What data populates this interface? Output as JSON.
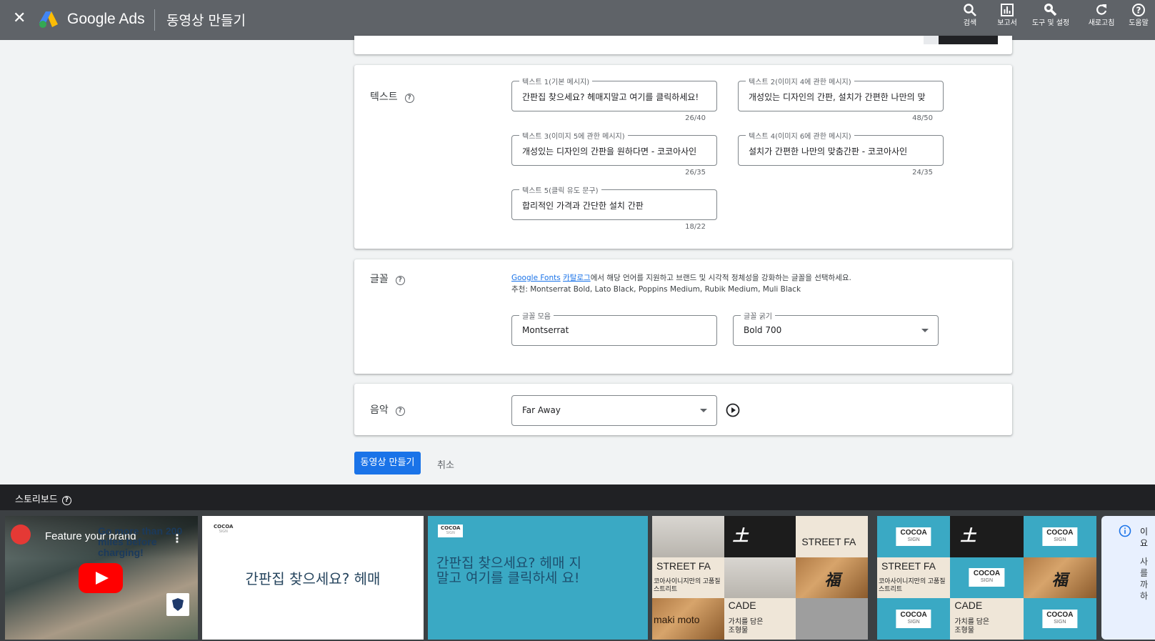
{
  "header": {
    "close_glyph": "✕",
    "brand": "Google Ads",
    "page_title": "동영상 만들기",
    "tools": [
      {
        "label": "검색",
        "icon": "search-icon"
      },
      {
        "label": "보고서",
        "icon": "bar-chart-icon"
      },
      {
        "label": "도구 및 설정",
        "icon": "wrench-icon"
      },
      {
        "label": "새로고침",
        "icon": "refresh-icon"
      },
      {
        "label": "도움말",
        "icon": "help-icon"
      }
    ],
    "bg_color": "#5f6368"
  },
  "text_section": {
    "title": "텍스트",
    "help_glyph": "?",
    "fields": [
      {
        "label": "텍스트 1(기본 메시지)",
        "value": "간판집 찾으세요? 헤매지말고 여기를 클릭하세요!",
        "counter": "26/40"
      },
      {
        "label": "텍스트 2(이미지 4에 관한 메시지)",
        "value": "개성있는 디자인의 간판, 설치가 간편한 나만의 맞",
        "counter": "48/50"
      },
      {
        "label": "텍스트 3(이미지 5에 관한 메시지)",
        "value": "개성있는 디자인의 간판을 원하다면 - 코코아사인",
        "counter": "26/35"
      },
      {
        "label": "텍스트 4(이미지 6에 관한 메시지)",
        "value": "설치가 간편한 나만의 맞춤간판 - 코코아사인",
        "counter": "24/35"
      },
      {
        "label": "텍스트 5(클릭 유도 문구)",
        "value": "합리적인 가격과 간단한 설치 간판",
        "counter": "18/22"
      }
    ]
  },
  "font_section": {
    "title": "글꼴",
    "help_glyph": "?",
    "link1": "Google Fonts",
    "link2": "카탈로그",
    "desc_rest": "에서 해당 언어를 지원하고 브랜드 및 시각적 정체성을 강화하는 글꼴을 선택하세요.",
    "recommend": "추천: Montserrat Bold, Lato Black, Poppins Medium, Rubik Medium, Muli Black",
    "family_label": "글꼴 모음",
    "family_value": "Montserrat",
    "weight_label": "글꼴 굵기",
    "weight_value": "Bold 700"
  },
  "music_section": {
    "title": "음악",
    "help_glyph": "?",
    "value": "Far Away"
  },
  "actions": {
    "create_label": "동영상 만들기",
    "cancel_label": "취소",
    "primary_color": "#1a73e8"
  },
  "storyboard": {
    "title": "스토리보드",
    "help_glyph": "?",
    "frame1": {
      "title": "Feature your brand",
      "subtitle": "Go more than 200 miles before charging!"
    },
    "cocoa": "COCOA",
    "sign": "SIGN",
    "frame2_text": "간판집 찾으세요? 헤매",
    "frame3_text": "간판집 찾으세요? 헤매 지말고 여기를 클릭하세 요!",
    "street": "STREET FA",
    "cade": "CADE",
    "tagline": "코아사이니지만의 고품질 스트리트",
    "value_text": "가치를 담은 조형물",
    "maki": "maki moto",
    "bar": "bar",
    "info_text1": "이 요",
    "info_text2": "사 를 까 하",
    "accent_teal": "#3aa9c4"
  }
}
